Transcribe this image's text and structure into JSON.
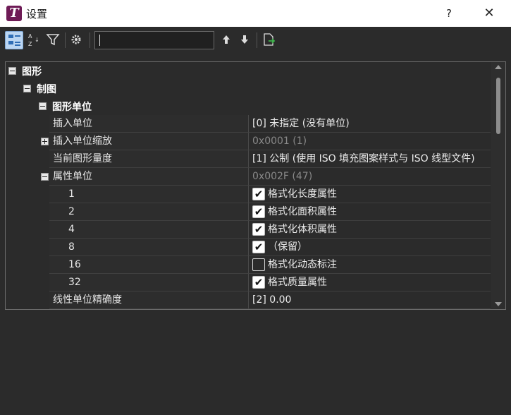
{
  "window": {
    "title": "设置",
    "help_label": "?",
    "close_label": "✕",
    "logo_letter": "T"
  },
  "toolbar": {
    "search_value": "",
    "buttons": [
      "categorized-view",
      "alphabetical-view",
      "filter",
      "settings",
      "move-up",
      "move-down",
      "export"
    ]
  },
  "tree": {
    "root_label": "图形",
    "section_label": "制图",
    "subsection_label": "图形单位",
    "properties": [
      {
        "name": "插入单位",
        "value": "[0] 未指定 (没有单位)",
        "dim": false
      },
      {
        "name": "插入单位缩放",
        "value": "0x0001 (1)",
        "dim": true
      },
      {
        "name": "当前图形量度",
        "value": "[1] 公制 (使用 ISO 填充图案样式与 ISO 线型文件)",
        "dim": false
      },
      {
        "name": "属性单位",
        "value": "0x002F (47)",
        "dim": true
      }
    ],
    "attribute_flags": [
      {
        "bit": "1",
        "label": "格式化长度属性",
        "checked": true
      },
      {
        "bit": "2",
        "label": "格式化面积属性",
        "checked": true
      },
      {
        "bit": "4",
        "label": "格式化体积属性",
        "checked": true
      },
      {
        "bit": "8",
        "label": "（保留）",
        "checked": true
      },
      {
        "bit": "16",
        "label": "格式化动态标注",
        "checked": false
      },
      {
        "bit": "32",
        "label": "格式质量属性",
        "checked": true
      }
    ],
    "last_property": {
      "name": "线性单位精确度",
      "value": "[2] 0.00"
    }
  },
  "check_mark": "✔"
}
